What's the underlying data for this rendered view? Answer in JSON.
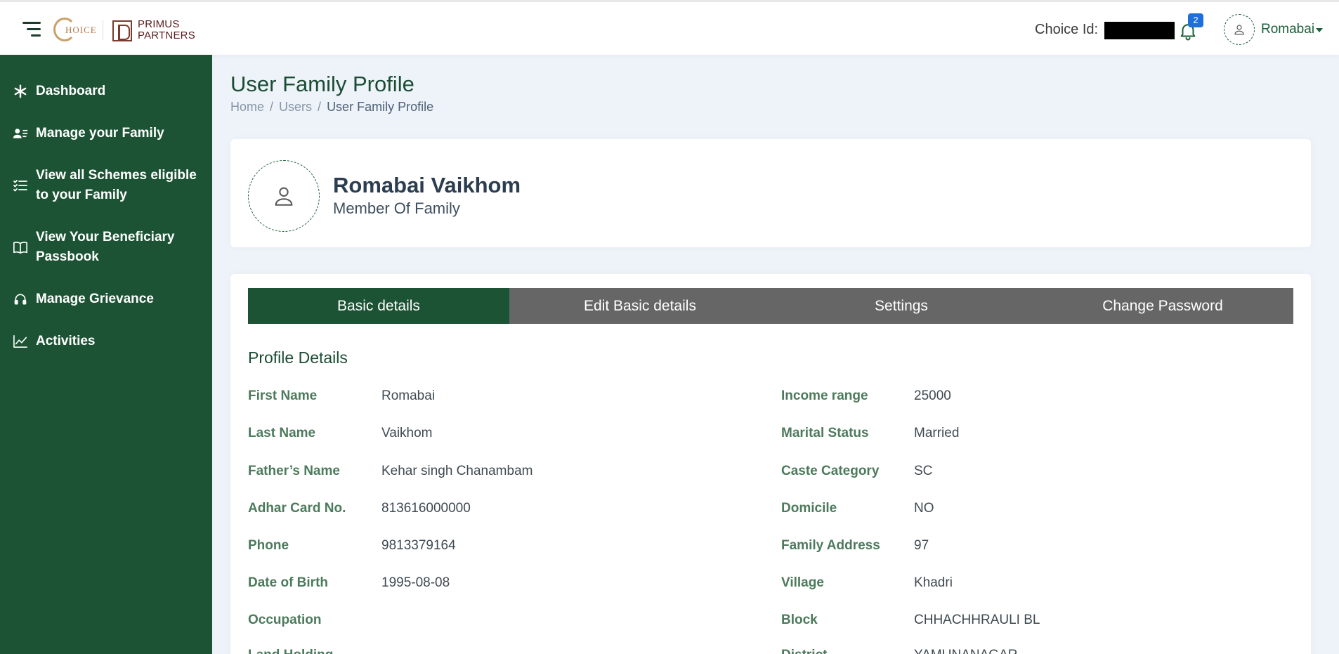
{
  "header": {
    "logo_choice": "HOICE",
    "logo_primus_line1": "PRIMUS",
    "logo_primus_line2": "PARTNERS",
    "choice_id_label": "Choice Id:",
    "notification_count": "2",
    "user_name": "Romabai"
  },
  "sidebar": {
    "items": [
      {
        "label": "Dashboard",
        "icon": "asterisk-icon"
      },
      {
        "label": "Manage your Family",
        "icon": "user-list-icon"
      },
      {
        "label": "View all Schemes eligible to your Family",
        "icon": "checklist-icon"
      },
      {
        "label": "View Your Beneficiary Passbook",
        "icon": "book-icon"
      },
      {
        "label": "Manage Grievance",
        "icon": "headset-icon"
      },
      {
        "label": "Activities",
        "icon": "chart-line-icon"
      }
    ]
  },
  "page": {
    "title": "User Family Profile",
    "breadcrumb": [
      "Home",
      "Users",
      "User Family Profile"
    ]
  },
  "profile": {
    "name": "Romabai Vaikhom",
    "role": "Member Of Family"
  },
  "tabs": [
    "Basic details",
    "Edit Basic details",
    "Settings",
    "Change Password"
  ],
  "details": {
    "section_title": "Profile Details",
    "left": [
      {
        "label": "First Name",
        "value": "Romabai"
      },
      {
        "label": "Last Name",
        "value": "Vaikhom"
      },
      {
        "label": "Father’s Name",
        "value": "Kehar singh Chanambam"
      },
      {
        "label": "Adhar Card No.",
        "value": "813616000000"
      },
      {
        "label": "Phone",
        "value": "9813379164"
      },
      {
        "label": "Date of Birth",
        "value": "1995-08-08"
      },
      {
        "label": "Occupation",
        "value": ""
      },
      {
        "label": "Land Holding",
        "value": ""
      }
    ],
    "right": [
      {
        "label": "Income range",
        "value": "25000"
      },
      {
        "label": "Marital Status",
        "value": "Married"
      },
      {
        "label": "Caste Category",
        "value": "SC"
      },
      {
        "label": "Domicile",
        "value": "NO"
      },
      {
        "label": "Family Address",
        "value": "97"
      },
      {
        "label": "Village",
        "value": "Khadri"
      },
      {
        "label": "Block",
        "value": "CHHACHHRAULI BL"
      },
      {
        "label": "District",
        "value": "YAMUNANAGAR"
      }
    ]
  },
  "colors": {
    "sidebar": "#1c5334",
    "tab_inactive": "#666666",
    "badge": "#1e6fd9",
    "label_green": "#4c7a5c"
  }
}
